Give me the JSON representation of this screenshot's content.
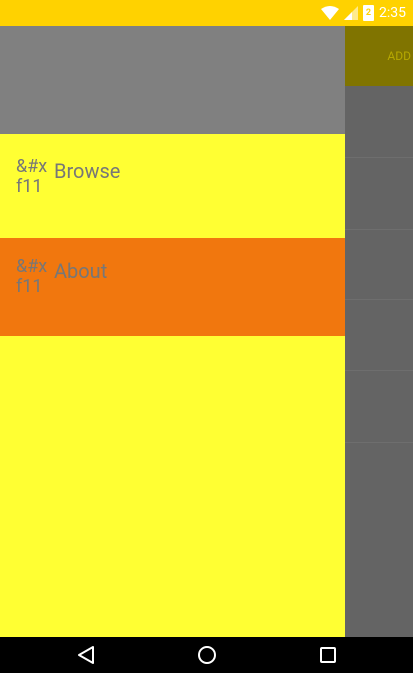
{
  "status_bar": {
    "time": "2:35",
    "battery_label": "2",
    "background_color": "#ffd200"
  },
  "background_screen": {
    "toolbar_action": "ADD",
    "toolbar_color": "#807400"
  },
  "drawer": {
    "header_color": "#808080",
    "background_color": "#ffff33",
    "items": [
      {
        "icon_text": "&#xf11",
        "label": "Browse",
        "selected": false,
        "background": "#ffff33"
      },
      {
        "icon_text": "&#xf11",
        "label": "About",
        "selected": true,
        "background": "#f1770e"
      }
    ]
  },
  "navigation_bar": {
    "buttons": [
      "back-icon",
      "home-icon",
      "recents-icon"
    ]
  }
}
